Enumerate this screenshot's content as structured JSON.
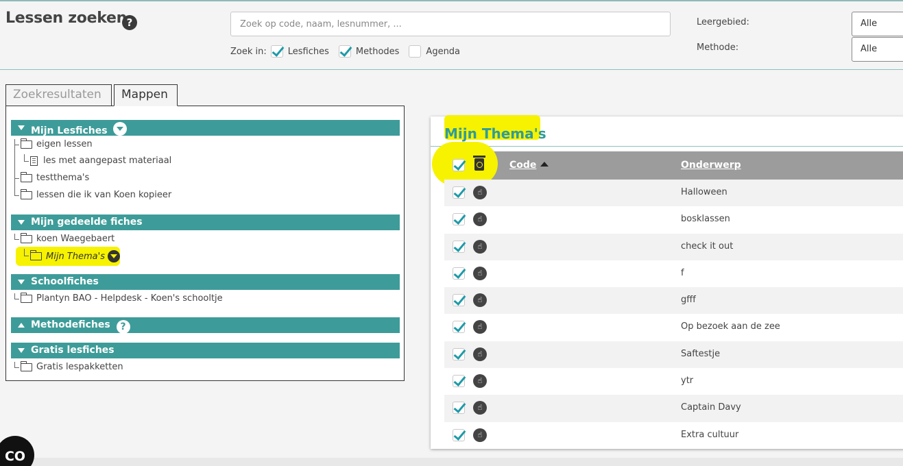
{
  "header": {
    "title": "Lessen zoeken",
    "help_icon": "?",
    "search_placeholder": "Zoek op code, naam, lesnummer, ...",
    "zoek_in_label": "Zoek in:",
    "zoek_in_options": [
      {
        "label": "Lesfiches",
        "checked": true
      },
      {
        "label": "Methodes",
        "checked": true
      },
      {
        "label": "Agenda",
        "checked": false
      }
    ],
    "leergebied_label": "Leergebied:",
    "leergebied_value": "Alle",
    "methode_label": "Methode:",
    "methode_value": "Alle"
  },
  "tabs": [
    {
      "label": "Zoekresultaten",
      "active": false
    },
    {
      "label": "Mappen",
      "active": true
    }
  ],
  "folders": {
    "mijn_lesfiches": {
      "label": "Mijn Lesfiches",
      "items": [
        "eigen lessen",
        "les met aangepast materiaal",
        "testthema's",
        "lessen die ik van Koen kopieer"
      ]
    },
    "gedeelde": {
      "label": "Mijn gedeelde fiches",
      "items": [
        "koen Waegebaert",
        "Mijn Thema's"
      ]
    },
    "school": {
      "label": "Schoolfiches",
      "items": [
        "Plantyn BAO - Helpdesk - Koen's schooltje"
      ]
    },
    "methode": {
      "label": "Methodefiches",
      "help": "?"
    },
    "gratis": {
      "label": "Gratis lesfiches",
      "items": [
        "Gratis lespakketten"
      ]
    }
  },
  "panel": {
    "title": "Mijn Thema's",
    "columns": {
      "code": "Code",
      "onderwerp": "Onderwerp"
    },
    "rows": [
      {
        "code": "",
        "onderwerp": "Halloween",
        "checked": true
      },
      {
        "code": "",
        "onderwerp": "bosklassen",
        "checked": true
      },
      {
        "code": "",
        "onderwerp": "check it out",
        "checked": true
      },
      {
        "code": "",
        "onderwerp": "f",
        "checked": true
      },
      {
        "code": "",
        "onderwerp": "gfff",
        "checked": true
      },
      {
        "code": "",
        "onderwerp": "Op bezoek aan de zee",
        "checked": true
      },
      {
        "code": "",
        "onderwerp": "Saftestje",
        "checked": true
      },
      {
        "code": "",
        "onderwerp": "ytr",
        "checked": true
      },
      {
        "code": "",
        "onderwerp": "Captain Davy",
        "checked": true
      },
      {
        "code": "",
        "onderwerp": "Extra cultuur",
        "checked": true
      }
    ]
  },
  "badge": "CO",
  "colors": {
    "accent": "#3d9c99",
    "highlight": "#f6f200",
    "check": "#1d9aa8"
  }
}
